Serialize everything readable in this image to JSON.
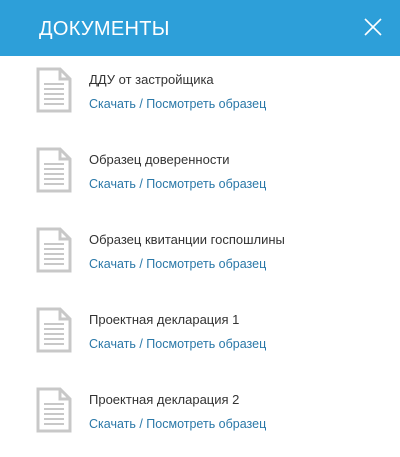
{
  "header": {
    "title": "ДОКУМЕНТЫ",
    "close_icon": "close-icon"
  },
  "documents": [
    {
      "title": "ДДУ от застройщика",
      "download_label": "Скачать",
      "separator": " / ",
      "preview_label": "Посмотреть образец",
      "icon": "document-icon"
    },
    {
      "title": "Образец доверенности",
      "download_label": "Скачать",
      "separator": " / ",
      "preview_label": "Посмотреть образец",
      "icon": "document-icon"
    },
    {
      "title": "Образец квитанции госпошлины",
      "download_label": "Скачать",
      "separator": " / ",
      "preview_label": "Посмотреть образец",
      "icon": "document-icon"
    },
    {
      "title": "Проектная декларация 1",
      "download_label": "Скачать",
      "separator": " / ",
      "preview_label": "Посмотреть образец",
      "icon": "document-icon"
    },
    {
      "title": "Проектная декларация 2",
      "download_label": "Скачать",
      "separator": " / ",
      "preview_label": "Посмотреть образец",
      "icon": "document-icon"
    }
  ],
  "colors": {
    "header_bg": "#2d9fd9",
    "link": "#2a78a8",
    "text": "#333333",
    "icon": "#c8c8c8"
  }
}
